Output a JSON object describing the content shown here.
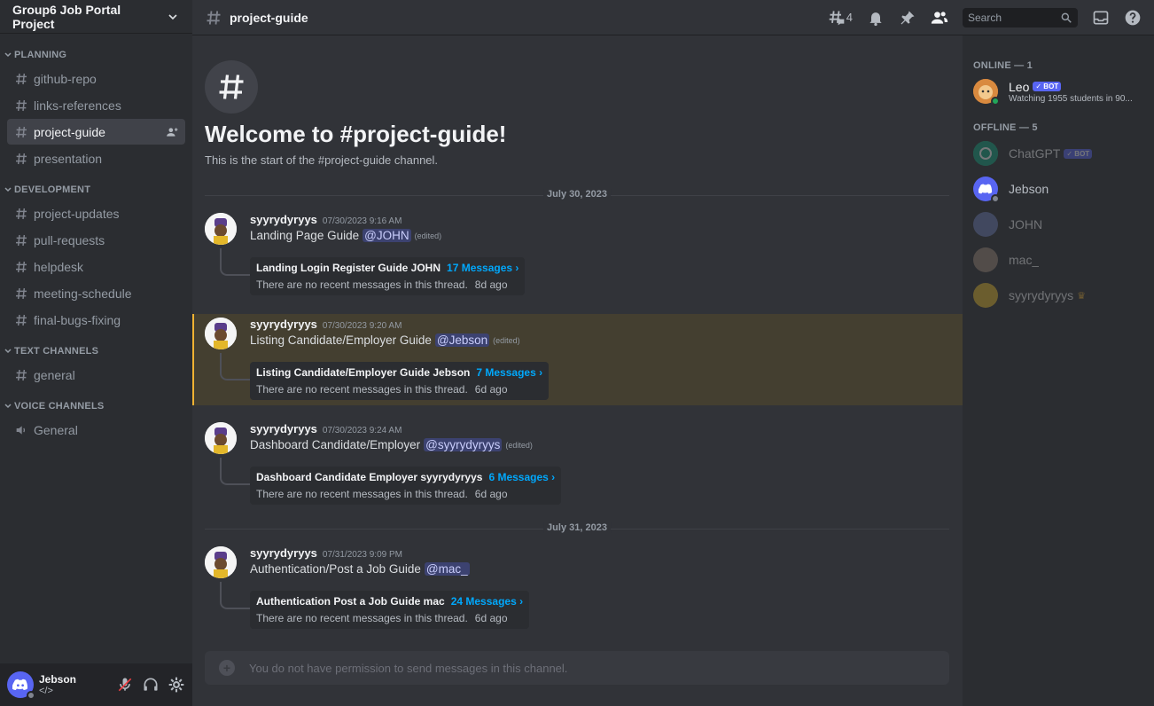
{
  "server": {
    "name": "Group6 Job Portal Project"
  },
  "categories": {
    "planning": "PLANNING",
    "development": "DEVELOPMENT",
    "text": "TEXT CHANNELS",
    "voice": "VOICE CHANNELS"
  },
  "channels": {
    "planning": [
      "github-repo",
      "links-references",
      "project-guide",
      "presentation"
    ],
    "development": [
      "project-updates",
      "pull-requests",
      "helpdesk",
      "meeting-schedule",
      "final-bugs-fixing"
    ],
    "text": [
      "general"
    ],
    "voice": [
      "General"
    ]
  },
  "user": {
    "name": "Jebson",
    "tag": "</>"
  },
  "header": {
    "channel": "project-guide",
    "thread_count": "4",
    "search_placeholder": "Search"
  },
  "welcome": {
    "title": "Welcome to #project-guide!",
    "subtitle": "This is the start of the #project-guide channel."
  },
  "dates": [
    "July 30, 2023",
    "July 31, 2023"
  ],
  "messages": [
    {
      "author": "syyrydyryys",
      "time": "07/30/2023 9:16 AM",
      "text": "Landing Page Guide",
      "mention": "@JOHN",
      "edited": "(edited)",
      "thread_title": "Landing Login Register Guide JOHN",
      "thread_count": "17 Messages ›",
      "thread_sub": "There are no recent messages in this thread.",
      "thread_age": "8d ago"
    },
    {
      "author": "syyrydyryys",
      "time": "07/30/2023 9:20 AM",
      "text": "Listing Candidate/Employer Guide",
      "mention": "@Jebson",
      "edited": "(edited)",
      "thread_title": "Listing Candidate/Employer Guide Jebson",
      "thread_count": "7 Messages ›",
      "thread_sub": "There are no recent messages in this thread.",
      "thread_age": "6d ago"
    },
    {
      "author": "syyrydyryys",
      "time": "07/30/2023 9:24 AM",
      "text": "Dashboard Candidate/Employer",
      "mention": "@syyrydyryys",
      "edited": "(edited)",
      "thread_title": "Dashboard Candidate Employer syyrydyryys",
      "thread_count": "6 Messages ›",
      "thread_sub": "There are no recent messages in this thread.",
      "thread_age": "6d ago"
    },
    {
      "author": "syyrydyryys",
      "time": "07/31/2023 9:09 PM",
      "text": "Authentication/Post a Job Guide",
      "mention": "@mac_",
      "edited": "",
      "thread_title": "Authentication Post a Job Guide mac",
      "thread_count": "24 Messages ›",
      "thread_sub": "There are no recent messages in this thread.",
      "thread_age": "6d ago"
    }
  ],
  "composer": {
    "placeholder": "You do not have permission to send messages in this channel."
  },
  "members": {
    "online_header": "ONLINE — 1",
    "offline_header": "OFFLINE — 5",
    "online": [
      {
        "name": "Leo",
        "badge": "✓ BOT",
        "sub": "Watching 1955 students in 90..."
      }
    ],
    "offline": [
      {
        "name": "ChatGPT",
        "badge": "✓ BOT"
      },
      {
        "name": "Jebson"
      },
      {
        "name": "JOHN"
      },
      {
        "name": "mac_"
      },
      {
        "name": "syyrydyryys"
      }
    ]
  },
  "colors": {
    "accent": "#5865f2",
    "mention_bg": "#3c4270",
    "highlight_bg": "#443f30",
    "highlight_bar": "#f0b232",
    "link": "#00a8fc"
  }
}
